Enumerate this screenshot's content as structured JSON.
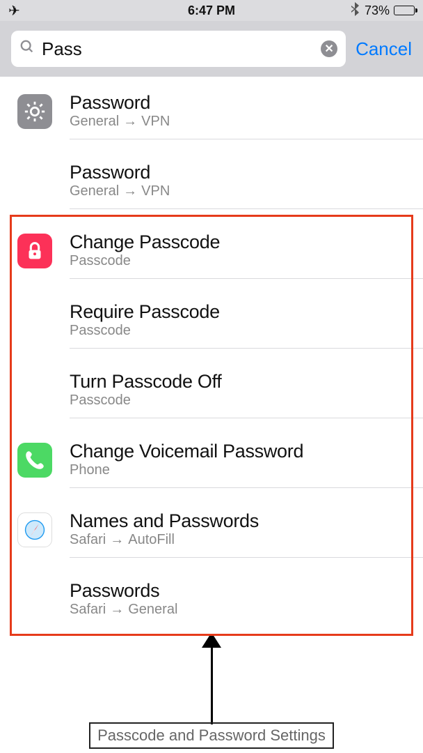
{
  "status": {
    "time": "6:47 PM",
    "battery_percent": "73%"
  },
  "search": {
    "value": "Pass",
    "cancel": "Cancel"
  },
  "results": [
    {
      "title": "Password",
      "path": [
        "General",
        "VPN"
      ],
      "icon": "gear"
    },
    {
      "title": "Password",
      "path": [
        "General",
        "VPN"
      ],
      "icon": ""
    },
    {
      "title": "Change Passcode",
      "path": [
        "Passcode"
      ],
      "icon": "lock"
    },
    {
      "title": "Require Passcode",
      "path": [
        "Passcode"
      ],
      "icon": ""
    },
    {
      "title": "Turn Passcode Off",
      "path": [
        "Passcode"
      ],
      "icon": ""
    },
    {
      "title": "Change Voicemail Password",
      "path": [
        "Phone"
      ],
      "icon": "phone"
    },
    {
      "title": "Names and Passwords",
      "path": [
        "Safari",
        "AutoFill"
      ],
      "icon": "safari"
    },
    {
      "title": "Passwords",
      "path": [
        "Safari",
        "General"
      ],
      "icon": ""
    }
  ],
  "annotation": {
    "caption": "Passcode and Password Settings"
  }
}
